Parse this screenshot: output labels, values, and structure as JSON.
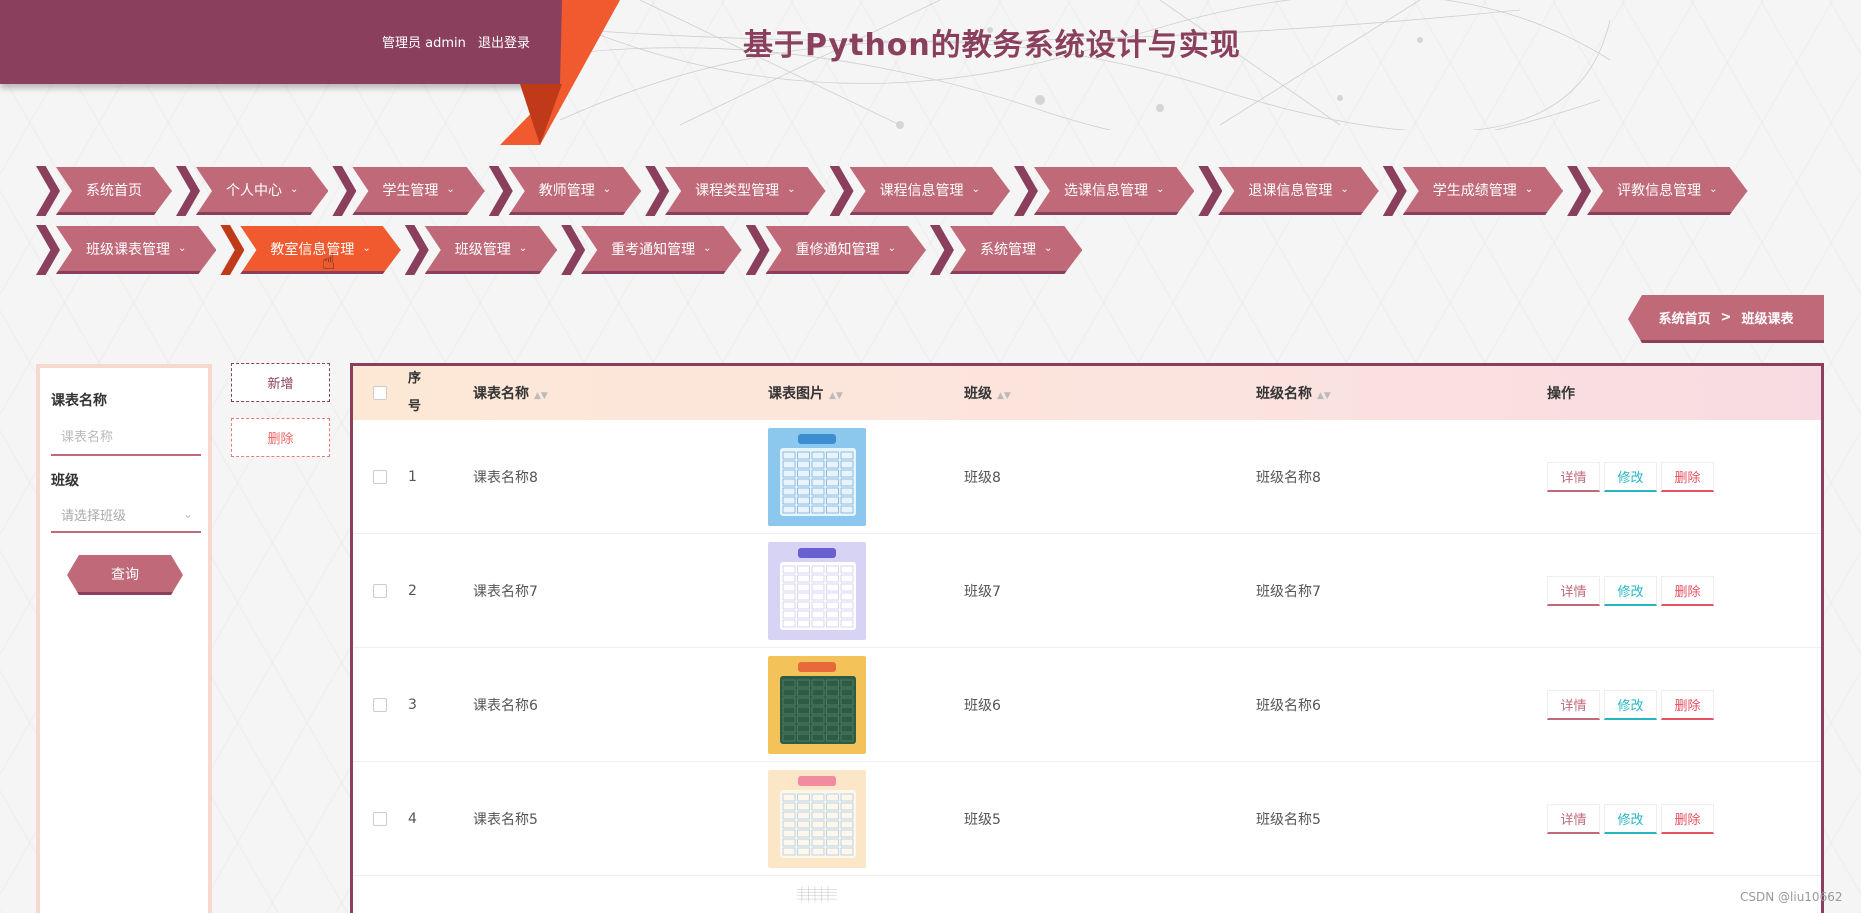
{
  "header": {
    "role_label": "管理员 admin",
    "logout_label": "退出登录",
    "site_title": "基于Python的教务系统设计与实现",
    "colors": {
      "primary": "#8a3f5c",
      "accent": "#f05a2e",
      "nav": "#c06a79"
    }
  },
  "nav": {
    "row1": [
      {
        "label": "系统首页",
        "caret": false
      },
      {
        "label": "个人中心",
        "caret": true
      },
      {
        "label": "学生管理",
        "caret": true
      },
      {
        "label": "教师管理",
        "caret": true
      },
      {
        "label": "课程类型管理",
        "caret": true
      },
      {
        "label": "课程信息管理",
        "caret": true
      },
      {
        "label": "选课信息管理",
        "caret": true
      },
      {
        "label": "退课信息管理",
        "caret": true
      },
      {
        "label": "学生成绩管理",
        "caret": true
      },
      {
        "label": "评教信息管理",
        "caret": true
      }
    ],
    "row2": [
      {
        "label": "班级课表管理",
        "caret": true,
        "active": false
      },
      {
        "label": "教室信息管理",
        "caret": true,
        "active": true
      },
      {
        "label": "班级管理",
        "caret": true,
        "active": false
      },
      {
        "label": "重考通知管理",
        "caret": true,
        "active": false
      },
      {
        "label": "重修通知管理",
        "caret": true,
        "active": false
      },
      {
        "label": "系统管理",
        "caret": true,
        "active": false
      }
    ],
    "caret_icon": "chevron-down-icon"
  },
  "breadcrumb": {
    "home": "系统首页",
    "separator": ">",
    "current": "班级课表"
  },
  "search": {
    "name_label": "课表名称",
    "name_placeholder": "课表名称",
    "class_label": "班级",
    "class_placeholder": "请选择班级",
    "query_button": "查询"
  },
  "actions": {
    "add": "新增",
    "delete": "删除"
  },
  "table": {
    "columns": {
      "index": "序号",
      "name": "课表名称",
      "image": "课表图片",
      "class": "班级",
      "class_name": "班级名称",
      "ops": "操作"
    },
    "rows": [
      {
        "index": "1",
        "name": "课表名称8",
        "class": "班级8",
        "class_name": "班级名称8",
        "thumb": "blue"
      },
      {
        "index": "2",
        "name": "课表名称7",
        "class": "班级7",
        "class_name": "班级名称7",
        "thumb": "purple"
      },
      {
        "index": "3",
        "name": "课表名称6",
        "class": "班级6",
        "class_name": "班级名称6",
        "thumb": "green"
      },
      {
        "index": "4",
        "name": "课表名称5",
        "class": "班级5",
        "class_name": "班级名称5",
        "thumb": "pastel"
      }
    ],
    "row_actions": {
      "detail": "详情",
      "edit": "修改",
      "remove": "删除"
    }
  },
  "watermark": "CSDN @liu10662"
}
